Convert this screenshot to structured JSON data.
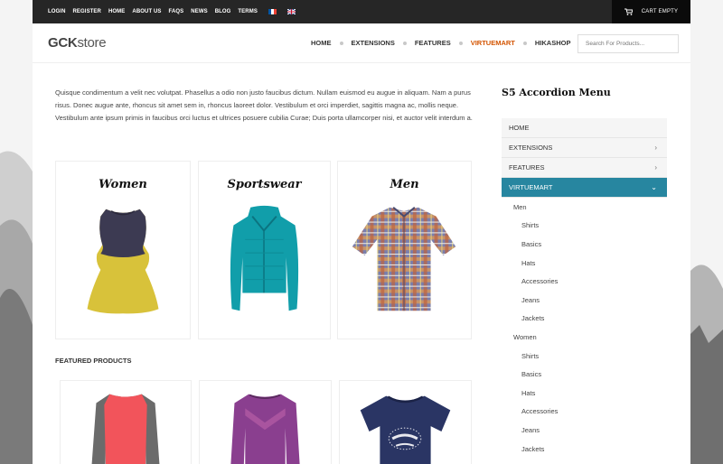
{
  "topbar": {
    "links": [
      "LOGIN",
      "REGISTER",
      "HOME",
      "ABOUT US",
      "FAQS",
      "NEWS",
      "BLOG",
      "TERMS"
    ],
    "cart_label": "CART EMPTY"
  },
  "header": {
    "logo_bold": "GCK",
    "logo_rest": "store",
    "nav": [
      "HOME",
      "EXTENSIONS",
      "FEATURES",
      "VIRTUEMART",
      "HIKASHOP"
    ],
    "active_nav": "VIRTUEMART",
    "search_placeholder": "Search For Products...",
    "accent_color": "#d35400"
  },
  "intro_text": "Quisque condimentum a velit nec volutpat. Phasellus a odio non justo faucibus dictum. Nullam euismod eu augue in aliquam. Nam a purus risus. Donec augue ante, rhoncus sit amet sem in, rhoncus laoreet dolor. Vestibulum et orci imperdiet, sagittis magna ac, mollis neque. Vestibulum ante ipsum primis in faucibus orci luctus et ultrices posuere cubilia Curae; Duis porta ullamcorper nisi, et auctor velit interdum a.",
  "categories": [
    {
      "title": "Women",
      "image": "yellow-peplum-top"
    },
    {
      "title": "Sportswear",
      "image": "teal-quilted-jacket"
    },
    {
      "title": "Men",
      "image": "plaid-shirt"
    }
  ],
  "featured": {
    "title": "FEATURED PRODUCTS",
    "items": [
      {
        "image": "coral-grey-raglan-top"
      },
      {
        "image": "purple-chevron-top"
      },
      {
        "image": "navy-varsity-tee"
      }
    ]
  },
  "sidebar": {
    "title": "S5 Accordion Menu",
    "menu": [
      {
        "label": "HOME",
        "has_children": false
      },
      {
        "label": "EXTENSIONS",
        "has_children": true
      },
      {
        "label": "FEATURES",
        "has_children": true
      },
      {
        "label": "VIRTUEMART",
        "has_children": true,
        "open": true
      }
    ],
    "submenu": [
      {
        "label": "Men",
        "level": 1
      },
      {
        "label": "Shirts",
        "level": 2
      },
      {
        "label": "Basics",
        "level": 2
      },
      {
        "label": "Hats",
        "level": 2
      },
      {
        "label": "Accessories",
        "level": 2
      },
      {
        "label": "Jeans",
        "level": 2
      },
      {
        "label": "Jackets",
        "level": 2
      },
      {
        "label": "Women",
        "level": 1
      },
      {
        "label": "Shirts",
        "level": 2
      },
      {
        "label": "Basics",
        "level": 2
      },
      {
        "label": "Hats",
        "level": 2
      },
      {
        "label": "Accessories",
        "level": 2
      },
      {
        "label": "Jeans",
        "level": 2
      },
      {
        "label": "Jackets",
        "level": 2
      }
    ],
    "active_color": "#2786a0"
  }
}
